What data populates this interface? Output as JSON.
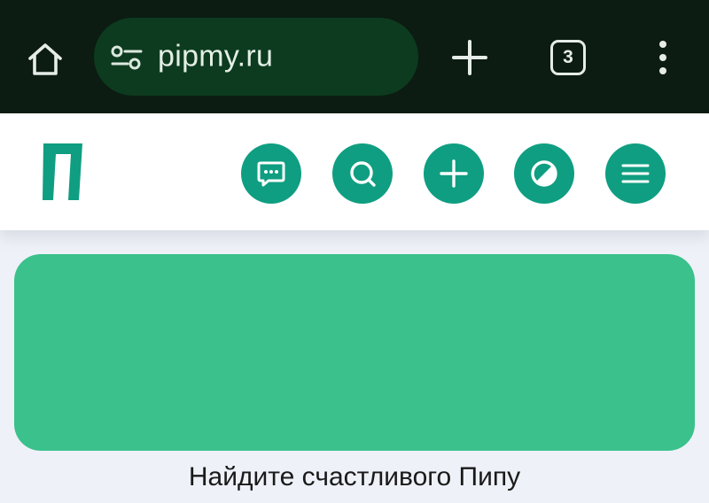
{
  "browser": {
    "url": "pipmy.ru",
    "tab_count": "3"
  },
  "site": {
    "logo_letter": "П",
    "header_buttons": [
      "chat-icon",
      "search-icon",
      "plus-icon",
      "theme-icon",
      "hamburger-icon"
    ],
    "accent_color": "#0f9e81",
    "banner_color": "#3ac18c"
  },
  "caption": "Найдите счастливого Пипу"
}
